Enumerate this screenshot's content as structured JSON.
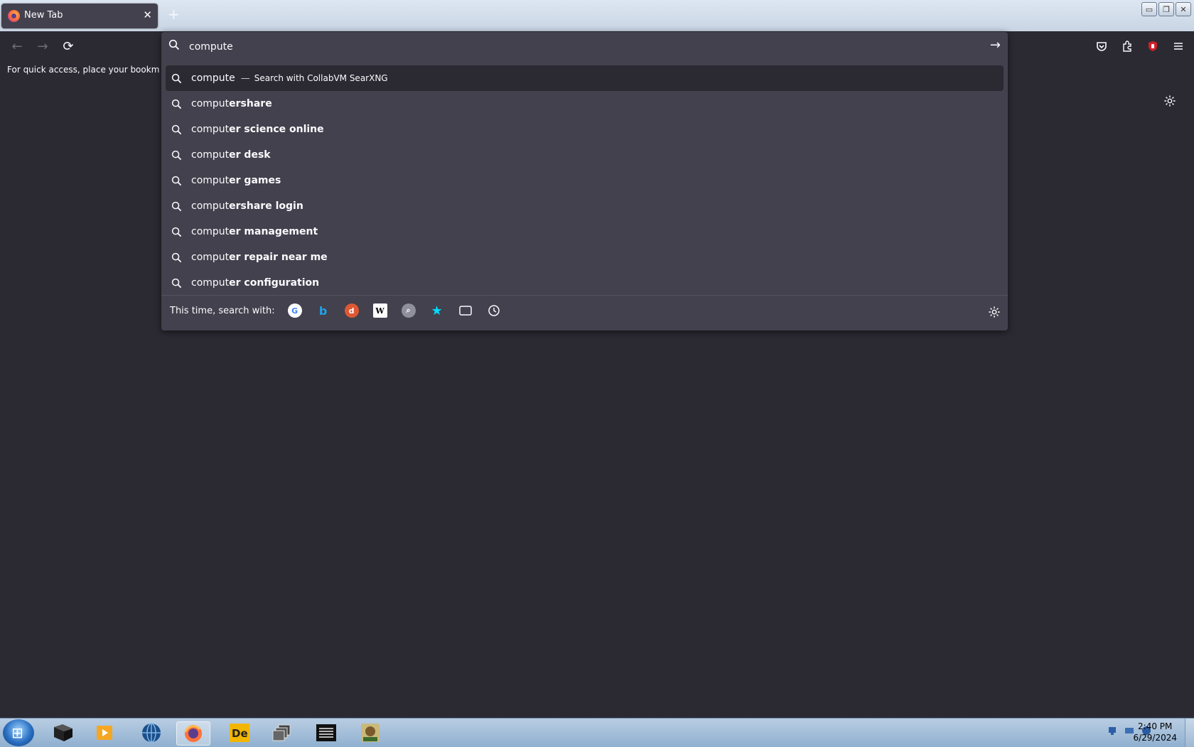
{
  "tab": {
    "title": "New Tab",
    "close": "✕",
    "new_tab": "+"
  },
  "window_controls": {
    "minimize": "▭",
    "maximize": "❐",
    "close": "✕"
  },
  "navbar": {
    "back": "←",
    "forward": "→",
    "reload": "⟳",
    "bookmarks_hint": "For quick access, place your bookmarks h"
  },
  "urlbar": {
    "value": "compute",
    "go": "→",
    "results": [
      {
        "typed": "compute",
        "completion": "",
        "action": "Search with CollabVM SearXNG",
        "selected": true
      },
      {
        "typed": "comput",
        "completion": "ershare"
      },
      {
        "typed": "comput",
        "completion": "er science online"
      },
      {
        "typed": "comput",
        "completion": "er desk"
      },
      {
        "typed": "comput",
        "completion": "er games"
      },
      {
        "typed": "comput",
        "completion": "ershare login"
      },
      {
        "typed": "comput",
        "completion": "er management"
      },
      {
        "typed": "comput",
        "completion": "er repair near me"
      },
      {
        "typed": "comput",
        "completion": "er configuration"
      }
    ],
    "search_with_label": "This time, search with:",
    "engines": [
      "google-icon",
      "bing-icon",
      "duckduckgo-icon",
      "wikipedia-icon",
      "searxng-icon",
      "bookmarks-icon",
      "tabs-icon",
      "history-icon"
    ]
  },
  "taskbar": {
    "clock_time": "2:40 PM",
    "clock_date": "6/29/2024",
    "apps": [
      "explorer",
      "media-player",
      "globe",
      "firefox",
      "de-app",
      "windows",
      "notepad",
      "game-box"
    ]
  },
  "colors": {
    "page_bg": "#2b2a33",
    "panel_bg": "#42414d",
    "text": "#fbfbfe"
  }
}
